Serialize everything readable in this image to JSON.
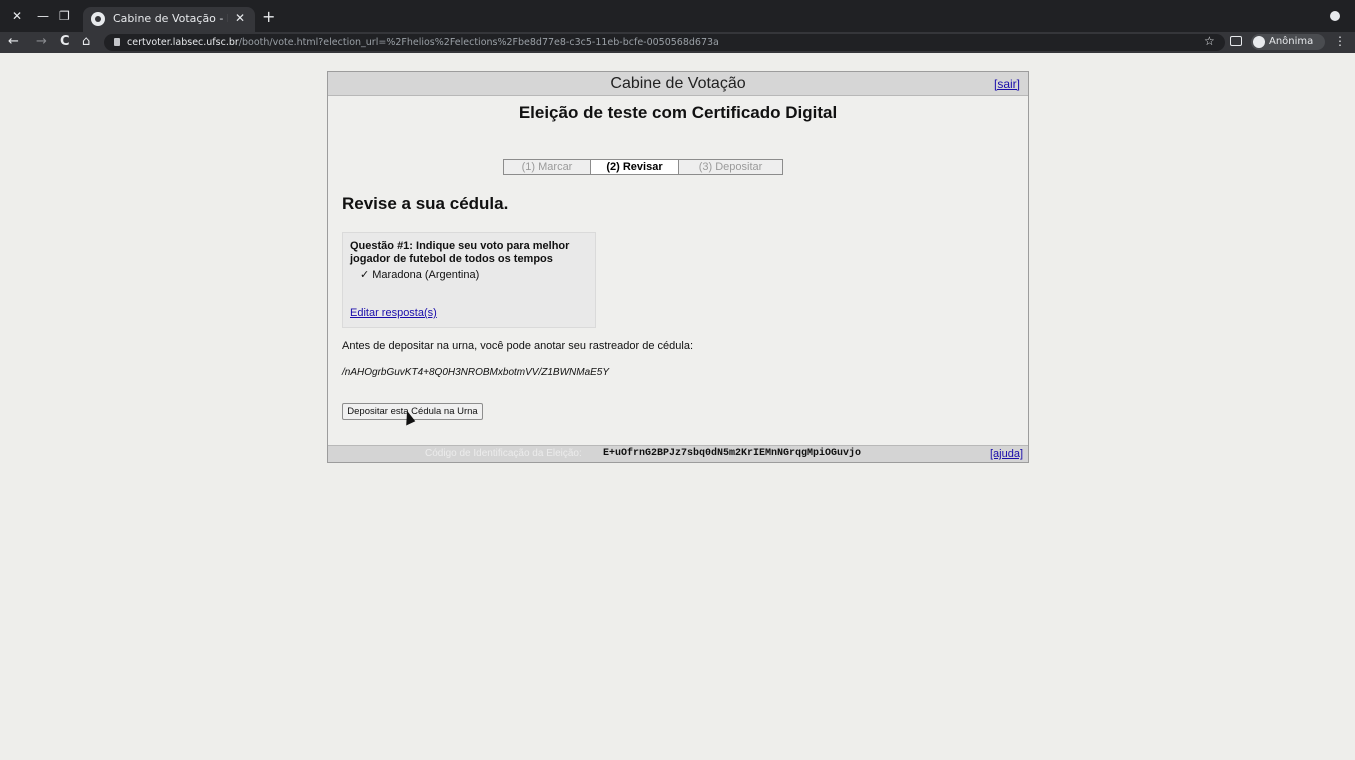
{
  "browser": {
    "close_btn": "✕",
    "minimize_btn": "—",
    "restore_btn": "❐",
    "tab_title": "Cabine de Votação - Eleiç",
    "tab_close": "✕",
    "new_tab": "+",
    "back": "←",
    "forward": "→",
    "reload": "C",
    "home": "⌂",
    "url_host": "certvoter.labsec.ufsc.br",
    "url_path": "/booth/vote.html?election_url=%2Fhelios%2Felections%2Fbe8d77e8-c3c5-11eb-bcfe-0050568d673a",
    "bookmark": "☆",
    "profile_label": "Anônima",
    "menu": "⋮"
  },
  "booth": {
    "title": "Cabine de Votação",
    "exit_label": "[sair]",
    "election_name": "Eleição de teste com Certificado Digital",
    "steps": [
      {
        "label": "(1) Marcar",
        "active": false
      },
      {
        "label": "(2) Revisar",
        "active": true
      },
      {
        "label": "(3) Depositar",
        "active": false
      }
    ],
    "heading": "Revise a sua cédula.",
    "question": {
      "title": "Questão #1: Indique seu voto para melhor jogador de futebol de todos os tempos",
      "answer": "✓ Maradona (Argentina)",
      "edit_label": "Editar resposta(s)"
    },
    "info_text": "Antes de depositar na urna, você pode anotar seu rastreador de cédula:",
    "tracker": "/nAHOgrbGuvKT4+8Q0H3NROBMxbotmVV/Z1BWNMaE5Y",
    "cast_button": "Depositar esta Cédula na Urna",
    "footer": {
      "label": "Código de Identificação da Eleição:",
      "code": "E+uOfrnG2BPJz7sbq0dN5m2KrIEMnNGrqgMpiOGuvjo",
      "help_label": "[ajuda]"
    }
  },
  "colors": {
    "page_bg": "#eeeeeb",
    "chrome_dark": "#202124",
    "link": "#1a0dab"
  }
}
